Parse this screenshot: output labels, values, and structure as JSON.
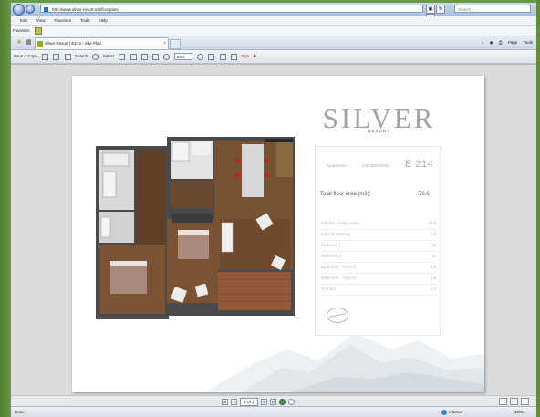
{
  "browser": {
    "address": "http://www.silver-resort.net/floorplan/",
    "search_placeholder": "Search",
    "menu": [
      "Edit",
      "View",
      "Favorites",
      "Tools",
      "Help"
    ],
    "favorites_label": "Favorites",
    "tab_title": "Silver Resort | E214 - Site Plan",
    "command_bar": {
      "page_label": "Page",
      "tools_label": "Tools"
    }
  },
  "pdf_toolbar": {
    "save_copy_label": "Save a Copy",
    "search_label": "Search",
    "select_label": "Select",
    "zoom_value": "62%",
    "sign_label": "Sign"
  },
  "document": {
    "brand": "SILVER",
    "brand_sub": "RESORT",
    "apartment_label": "Apartment",
    "apartment_type": "3 BEDROOMS",
    "apartment_code": "E 214",
    "total_area_label": "Total floor area (m2):",
    "total_area_value": "76.6",
    "rooms": [
      {
        "name": "Kitchen - Living room",
        "area": "28.8"
      },
      {
        "name": "Internal Balcony",
        "area": "4.8"
      },
      {
        "name": "Bedroom 1",
        "area": "15"
      },
      {
        "name": "Bedroom 2",
        "area": "15"
      },
      {
        "name": "Bathroom - Toilet 1",
        "area": "4.8"
      },
      {
        "name": "Bathroom - Toilet 2",
        "area": "3.8"
      },
      {
        "name": "Corridor",
        "area": "8.4"
      }
    ]
  },
  "navigation": {
    "page_indicator": "1 of 1"
  },
  "status_bar": {
    "status_text": "Done",
    "zone_text": "Internet",
    "zoom_text": "100%"
  },
  "colors": {
    "wood_floor": "#6e4a2a",
    "carpet": "#a88a7a",
    "wall": "#3a3a3a",
    "desktop_green": "#5c8a3c"
  }
}
